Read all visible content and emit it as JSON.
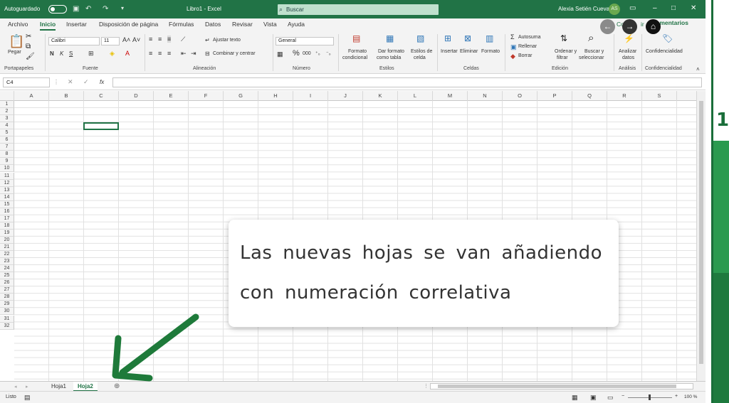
{
  "titlebar": {
    "autosave_label": "Autoguardado",
    "window_title": "Libro1  -  Excel",
    "search_placeholder": "Buscar",
    "user_name": "Alexia Setién Cueva",
    "user_initials": "AS"
  },
  "ribbon_tabs": [
    "Archivo",
    "Inicio",
    "Insertar",
    "Disposición de página",
    "Fórmulas",
    "Datos",
    "Revisar",
    "Vista",
    "Ayuda"
  ],
  "comments_label": "Comentarios",
  "share_fragment": "Co",
  "share_fragment2": "ir",
  "ribbon": {
    "paste_label": "Pegar",
    "clipboard_group": "Portapapeles",
    "font_name": "Calibri",
    "font_size": "11",
    "font_group": "Fuente",
    "bold": "N",
    "italic": "K",
    "underline": "S",
    "wrap_text": "Ajustar texto",
    "merge_center": "Combinar y centrar",
    "alignment_group": "Alineación",
    "number_format": "General",
    "number_group": "Número",
    "cond_format": [
      "Formato",
      "condicional"
    ],
    "format_table": [
      "Dar formato",
      "como tabla"
    ],
    "cell_styles": [
      "Estilos de",
      "celda"
    ],
    "styles_group": "Estilos",
    "insert": "Insertar",
    "delete": "Eliminar",
    "format": "Formato",
    "cells_group": "Celdas",
    "autosum": "Autosuma",
    "fill": "Rellenar",
    "clear": "Borrar",
    "sort_filter": [
      "Ordenar y",
      "filtrar"
    ],
    "find_select": [
      "Buscar y",
      "seleccionar"
    ],
    "editing_group": "Edición",
    "analyze": [
      "Analizar",
      "datos"
    ],
    "analysis_group": "Análisis",
    "confidentiality": "Confidencialidad",
    "confidentiality_group": "Confidencialidad"
  },
  "formula_bar": {
    "name_box": "C4",
    "fx_label": "fx"
  },
  "columns": [
    "A",
    "B",
    "C",
    "D",
    "E",
    "F",
    "G",
    "H",
    "I",
    "J",
    "K",
    "L",
    "M",
    "N",
    "O",
    "P",
    "Q",
    "R",
    "S"
  ],
  "rows": [
    "1",
    "2",
    "3",
    "4",
    "5",
    "6",
    "7",
    "8",
    "9",
    "10",
    "11",
    "12",
    "13",
    "14",
    "15",
    "16",
    "17",
    "18",
    "19",
    "20",
    "21",
    "22",
    "23",
    "24",
    "25",
    "26",
    "27",
    "28",
    "29",
    "30",
    "31",
    "32"
  ],
  "sheets": [
    "Hoja1",
    "Hoja2"
  ],
  "active_sheet": "Hoja2",
  "status": {
    "ready": "Listo",
    "zoom": "100 %"
  },
  "side_number": "1",
  "callout": {
    "line1": "Las nuevas hojas se van añadiendo",
    "line2": "con numeración correlativa"
  },
  "colors": {
    "excel_green": "#217346",
    "arrow_green": "#1e7a3a"
  }
}
